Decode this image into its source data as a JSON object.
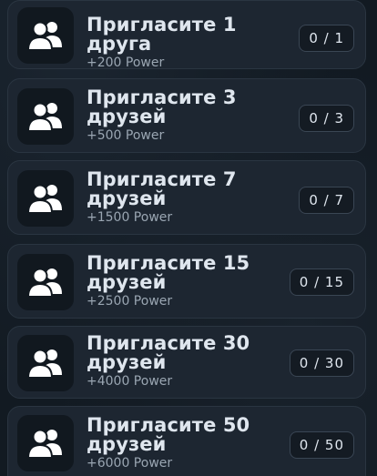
{
  "tasks": [
    {
      "title": "Пригласите 1 друга",
      "reward": "+200 Power",
      "progress": "0 / 1"
    },
    {
      "title": "Пригласите 3 друзей",
      "reward": "+500 Power",
      "progress": "0 / 3"
    },
    {
      "title": "Пригласите 7 друзей",
      "reward": "+1500 Power",
      "progress": "0 / 7"
    },
    {
      "title": "Пригласите 15 друзей",
      "reward": "+2500 Power",
      "progress": "0 / 15"
    },
    {
      "title": "Пригласите 30 друзей",
      "reward": "+4000 Power",
      "progress": "0 / 30"
    },
    {
      "title": "Пригласите 50 друзей",
      "reward": "+6000 Power",
      "progress": "0 / 50"
    }
  ],
  "icon": "users-icon",
  "colors": {
    "card": "#1d2631",
    "icon_bg": "#11181f",
    "text": "#dfe6ee",
    "subtext": "#9aa6b2"
  }
}
